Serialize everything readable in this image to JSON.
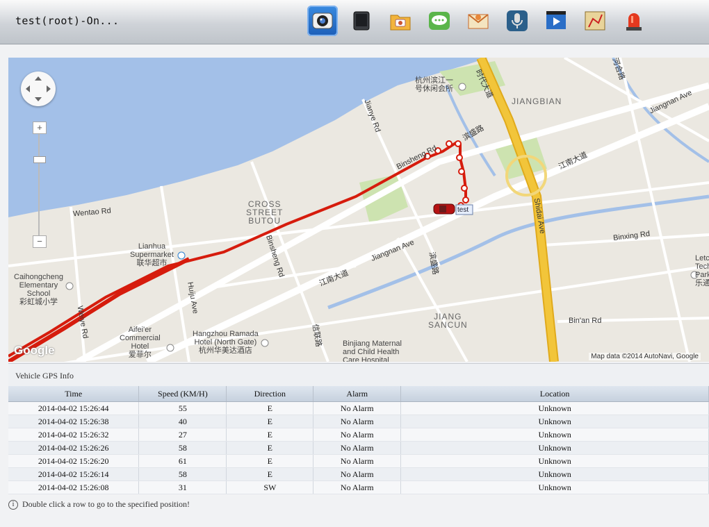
{
  "window": {
    "title": "test(root)-On..."
  },
  "toolbar": {
    "tools": [
      {
        "name": "camera-icon",
        "active": true
      },
      {
        "name": "tablet-icon",
        "active": false
      },
      {
        "name": "photo-folder-icon",
        "active": false
      },
      {
        "name": "chat-icon",
        "active": false
      },
      {
        "name": "mail-icon",
        "active": false
      },
      {
        "name": "microphone-icon",
        "active": false
      },
      {
        "name": "video-icon",
        "active": false
      },
      {
        "name": "map-route-icon",
        "active": false
      },
      {
        "name": "alarm-light-icon",
        "active": false
      }
    ]
  },
  "map": {
    "labels": {
      "binjiang_club": "杭州滨江一\n号休闲会所",
      "jiangbian": "JIANGBIAN",
      "shidai_cn": "时代大道",
      "binsheng_cn": "滨盛路",
      "jianye": "Jianye Rd",
      "binsheng": "Binsheng Rd",
      "jiangnan_ave_top": "Jiangnan Ave",
      "jiangnan_cn_top": "江南大道",
      "wentao": "Wentao Rd",
      "cross_street": "CROSS\nSTREET\nBUTOU",
      "lianhua": "Lianhua\nSupermarket\n联华超市",
      "caihong": "Caihongcheng\nElementary\nSchool\n彩虹城小学",
      "huiju": "Huiju Ave",
      "binsheng_rd2": "Binsheng Rd",
      "jiangnan_ave": "Jiangnan Ave",
      "jiangnan_cn": "江南大道",
      "binsheng_cn2": "滨盛路",
      "shidai_ave": "Shidai Ave",
      "binxing": "Binxing Rd",
      "binan": "Bin'an Rd",
      "jiang_sancun": "JIANG\nSANCUN",
      "aifeier": "Aifei'er\nCommercial\nHotel\n爱菲尔",
      "ramada": "Hangzhou Ramada\nHotel (North Gate)\n杭州华美达酒店",
      "xinlian": "信联路",
      "weiye": "Weiye Rd",
      "maternal": "Binjiang Maternal\nand Child Health\nCare Hospital",
      "hehe": "河合路",
      "letc": "Letc\nTech\nPark\n乐通",
      "vehicle": "test"
    },
    "google": "Google",
    "attribution": "Map data ©2014 AutoNavi, Google",
    "colors": {
      "water": "#a3c0e8",
      "park": "#cde3b0",
      "highway": "#f2c53a",
      "track": "#d61c0d"
    }
  },
  "gps": {
    "title": "Vehicle GPS Info",
    "columns": [
      "Time",
      "Speed (KM/H)",
      "Direction",
      "Alarm",
      "Location"
    ],
    "rows": [
      [
        "2014-04-02 15:26:44",
        "55",
        "E",
        "No Alarm",
        "Unknown"
      ],
      [
        "2014-04-02 15:26:38",
        "40",
        "E",
        "No Alarm",
        "Unknown"
      ],
      [
        "2014-04-02 15:26:32",
        "27",
        "E",
        "No Alarm",
        "Unknown"
      ],
      [
        "2014-04-02 15:26:26",
        "58",
        "E",
        "No Alarm",
        "Unknown"
      ],
      [
        "2014-04-02 15:26:20",
        "61",
        "E",
        "No Alarm",
        "Unknown"
      ],
      [
        "2014-04-02 15:26:14",
        "58",
        "E",
        "No Alarm",
        "Unknown"
      ],
      [
        "2014-04-02 15:26:08",
        "31",
        "SW",
        "No Alarm",
        "Unknown"
      ]
    ],
    "hint": "Double click a row to go to the specified position!"
  }
}
